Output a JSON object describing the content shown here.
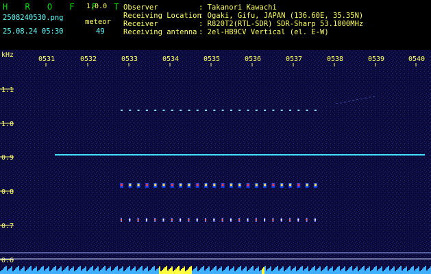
{
  "header": {
    "app_name": "H R O F F T",
    "version": "1.0.0",
    "file_name": "2508240530.png",
    "datetime": "25.08.24 05:30",
    "meteor_label": "meteor",
    "meteor_count": "49",
    "info_labels": [
      "Observer",
      "Receiving Location",
      "Receiver",
      "Receiving antenna"
    ],
    "info_values": [
      ": Takanori Kawachi",
      ": Ogaki, Gifu, JAPAN (136.60E, 35.35N)",
      ": R820T2(RTL-SDR) SDR-Sharp 53.1000MHz",
      ": 2el-HB9CV Vertical (el. E-W)"
    ]
  },
  "axes": {
    "y_unit": "kHz",
    "y_ticks": [
      "1.1",
      "1.0",
      "0.9",
      "0.8",
      "0.7",
      "0.6"
    ],
    "x_ticks": [
      "0531",
      "0532",
      "0533",
      "0534",
      "0535",
      "0536",
      "0537",
      "0538",
      "0539",
      "0540"
    ]
  },
  "colors": {
    "background": "#0c0a3a",
    "label_yellow": "#ffff66",
    "logo_green": "#00e000",
    "carrier_cyan": "#40e0ff"
  }
}
